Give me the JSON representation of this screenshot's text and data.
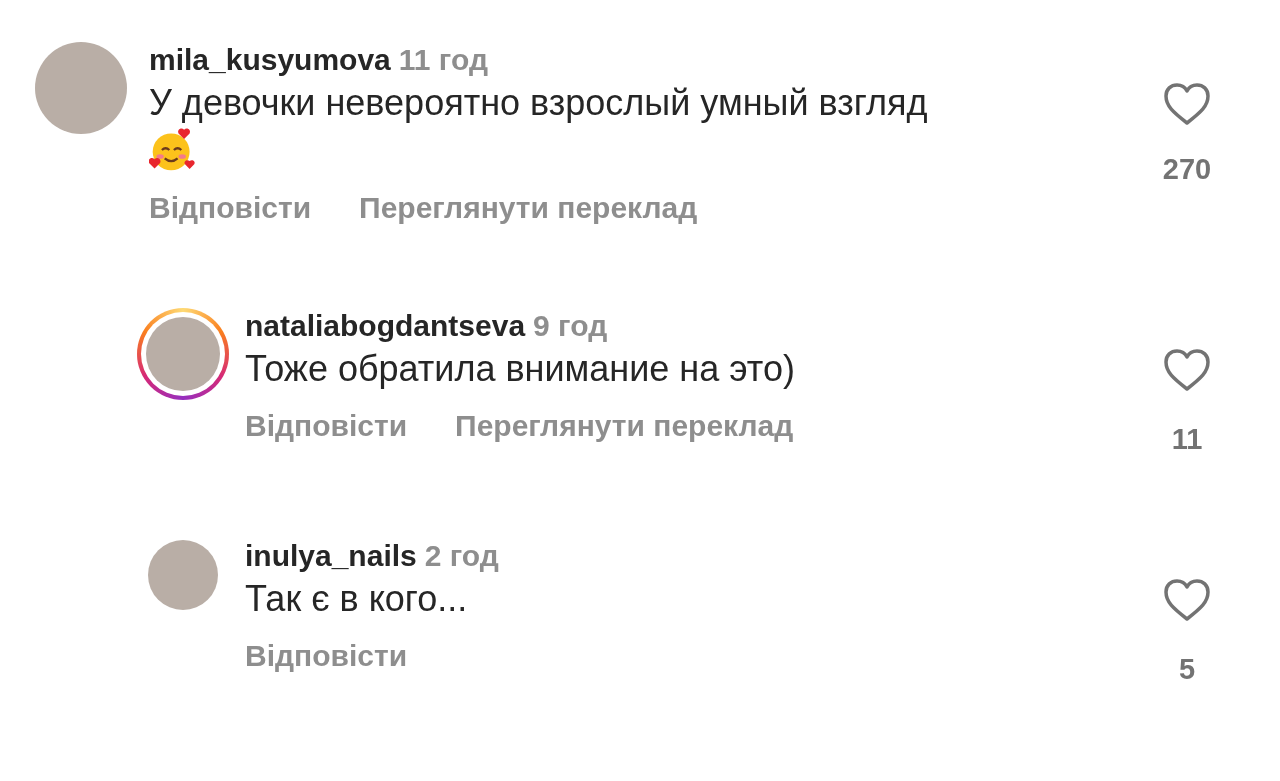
{
  "comments": [
    {
      "username": "mila_kusyumova",
      "time": "11 год",
      "text": "У девочки невероятно взрослый умный взгляд",
      "emoji": true,
      "story_ring": false,
      "liked": false,
      "likes": "270",
      "actions": [
        "Відповісти",
        "Переглянути переклад"
      ],
      "replies": [
        {
          "username": "nataliabogdantseva",
          "time": "9 год",
          "text": "Тоже обратила внимание на это)",
          "story_ring": true,
          "liked": false,
          "likes": "11",
          "actions": [
            "Відповісти",
            "Переглянути переклад"
          ]
        },
        {
          "username": "inulya_nails",
          "time": "2 год",
          "text": "Так є в кого...",
          "story_ring": false,
          "liked": false,
          "likes": "5",
          "actions": [
            "Відповісти"
          ]
        }
      ]
    }
  ]
}
